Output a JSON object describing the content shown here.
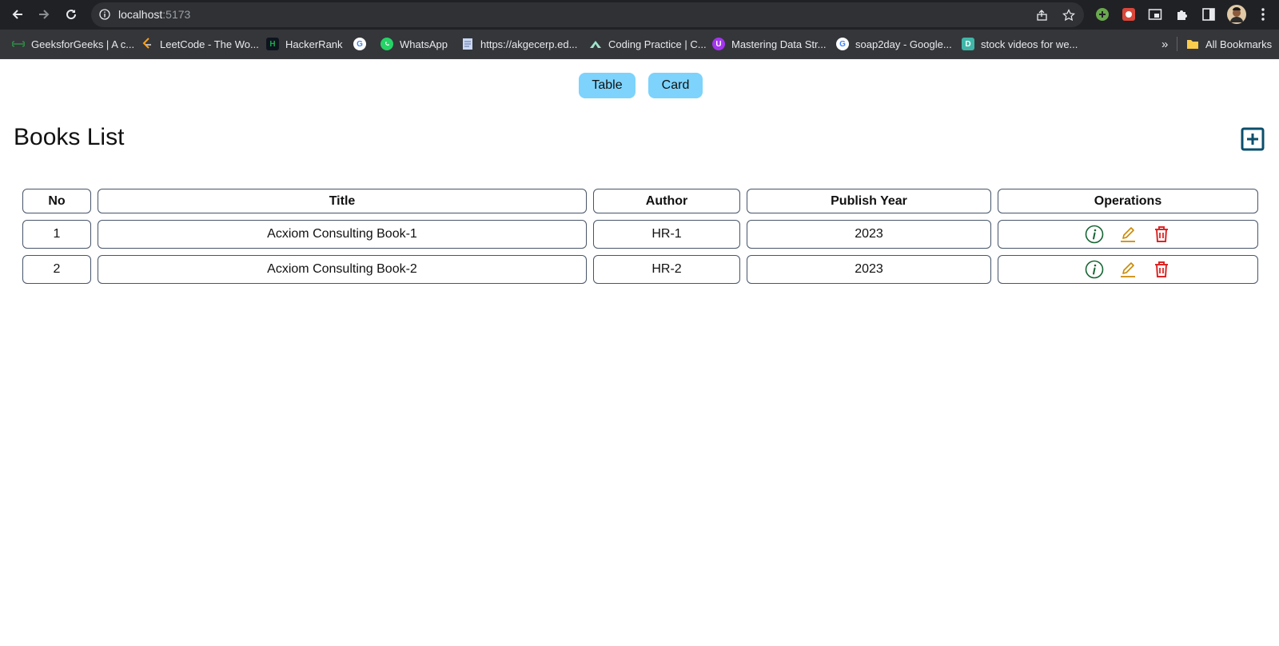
{
  "browser": {
    "url_host": "localhost",
    "url_port": ":5173",
    "bookmarks": [
      {
        "label": "GeeksforGeeks | A c...",
        "icon": "gfg-icon",
        "color": "#2f8d46"
      },
      {
        "label": "LeetCode - The Wo...",
        "icon": "leetcode-icon",
        "color": "#ffa116"
      },
      {
        "label": "HackerRank",
        "icon": "hackerrank-icon",
        "color": "#1ba94c"
      },
      {
        "label": "",
        "icon": "google-icon",
        "color": "#4285f4"
      },
      {
        "label": "WhatsApp",
        "icon": "whatsapp-icon",
        "color": "#25d366"
      },
      {
        "label": "https://akgecerp.ed...",
        "icon": "document-icon",
        "color": "#8ab4f8"
      },
      {
        "label": "Coding Practice | C...",
        "icon": "codingninjas-icon",
        "color": "#a0e4cb"
      },
      {
        "label": "Mastering Data Str...",
        "icon": "udemy-icon",
        "color": "#a435f0"
      },
      {
        "label": "soap2day - Google...",
        "icon": "google-icon",
        "color": "#4285f4"
      },
      {
        "label": "stock videos for we...",
        "icon": "d-icon",
        "color": "#3fb6a8"
      }
    ],
    "more_label": "»",
    "all_bookmarks_label": "All Bookmarks"
  },
  "view_toggle": {
    "table_label": "Table",
    "card_label": "Card"
  },
  "page_title": "Books List",
  "table": {
    "columns": [
      "No",
      "Title",
      "Author",
      "Publish Year",
      "Operations"
    ],
    "rows": [
      {
        "no": "1",
        "title": "Acxiom Consulting Book-1",
        "author": "HR-1",
        "year": "2023"
      },
      {
        "no": "2",
        "title": "Acxiom Consulting Book-2",
        "author": "HR-2",
        "year": "2023"
      }
    ]
  },
  "colors": {
    "toggle_bg": "#7dd3fc",
    "add_icon": "#0b4f6c",
    "info_icon": "#166534",
    "edit_icon": "#ca8a04",
    "delete_icon": "#dc2626"
  }
}
